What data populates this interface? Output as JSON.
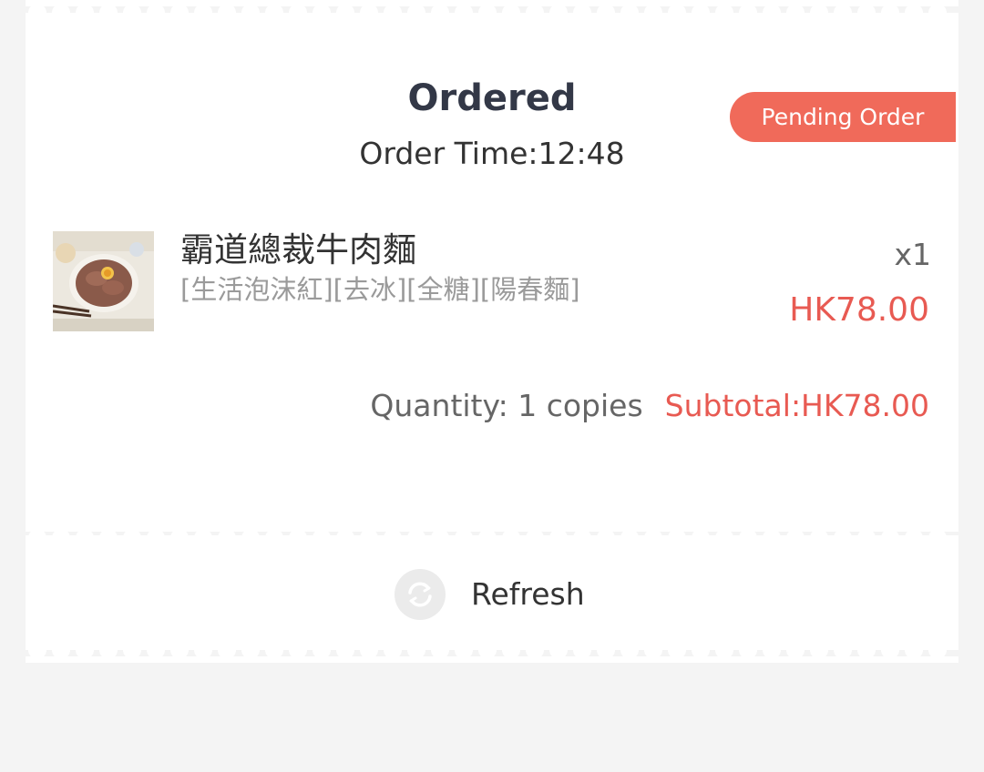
{
  "header": {
    "title": "Ordered",
    "order_time": "Order Time:12:48",
    "status_badge": "Pending Order"
  },
  "colors": {
    "accent": "#f06a5a",
    "price": "#e85a52",
    "title": "#333847",
    "background": "#f4f4f4"
  },
  "items": [
    {
      "name": "霸道總裁牛肉麵",
      "options": "[生活泡沫紅][去冰][全糖][陽春麵]",
      "quantity": "x1",
      "price": "HK78.00",
      "image_icon": "beef-noodle-photo"
    }
  ],
  "summary": {
    "quantity_text": "Quantity: 1 copies",
    "subtotal_text": "Subtotal:HK78.00"
  },
  "actions": {
    "refresh_label": "Refresh",
    "refresh_icon": "refresh-icon"
  }
}
